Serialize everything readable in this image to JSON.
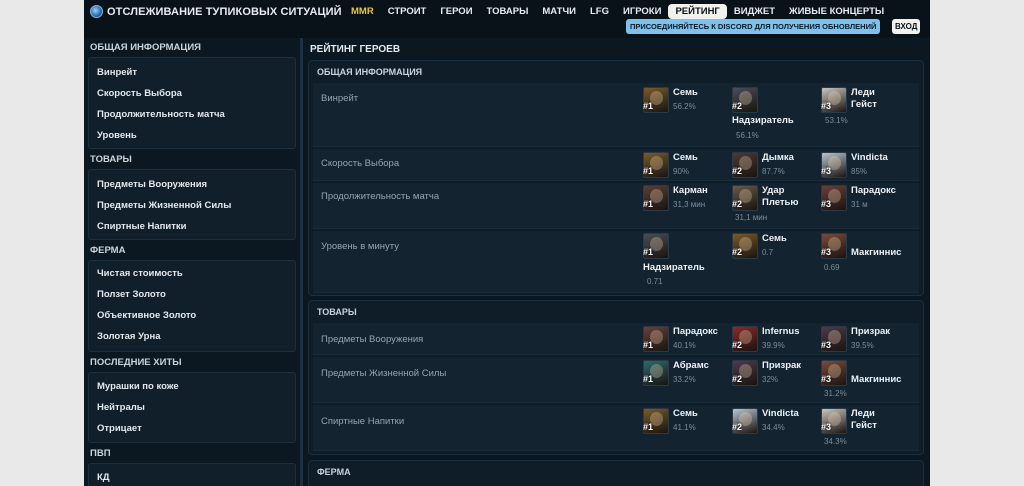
{
  "nav": {
    "brand_title": "ОТСЛЕЖИВАНИЕ ТУПИКОВЫХ СИТУАЦИЙ",
    "links": [
      "MMR",
      "СТРОИТ",
      "ГЕРОИ",
      "ТОВАРЫ",
      "МАТЧИ",
      "LFG",
      "ИГРОКИ",
      "РЕЙТИНГ",
      "ВИДЖЕТ",
      "ЖИВЫЕ КОНЦЕРТЫ"
    ],
    "active_link": "РЕЙТИНГ",
    "discord_banner": "ПРИСОЕДИНЯЙТЕСЬ К DISCORD ДЛЯ ПОЛУЧЕНИЯ ОБНОВЛЕНИЙ",
    "login_label": "ВХОД"
  },
  "sidebar": {
    "sections": [
      {
        "title": "ОБЩАЯ ИНФОРМАЦИЯ",
        "items": [
          "Винрейт",
          "Скорость Выбора",
          "Продолжительность матча",
          "Уровень"
        ]
      },
      {
        "title": "ТОВАРЫ",
        "items": [
          "Предметы Вооружения",
          "Предметы Жизненной Силы",
          "Спиртные Напитки"
        ]
      },
      {
        "title": "ФЕРМА",
        "items": [
          "Чистая стоимость",
          "Ползет Золото",
          "Объективное Золото",
          "Золотая Урна"
        ]
      },
      {
        "title": "ПОСЛЕДНИЕ ХИТЫ",
        "items": [
          "Мурашки по коже",
          "Нейтралы",
          "Отрицает"
        ]
      },
      {
        "title": "ПВП",
        "items": [
          "КД"
        ]
      }
    ]
  },
  "main": {
    "title": "РЕЙТИНГ ГЕРОЕВ",
    "panels": [
      {
        "title": "ОБЩАЯ ИНФОРМАЦИЯ",
        "rows": [
          {
            "label": "Винрейт",
            "heroes": [
              {
                "rank": "#1",
                "name": "Семь",
                "value": "56.2%",
                "color": "#7a5a2a"
              },
              {
                "rank": "#2",
                "name": "Надзиратель",
                "value": "56.1%",
                "color": "#4a4e58"
              },
              {
                "rank": "#3",
                "name": "Леди Гейст",
                "value": "53.1%",
                "color": "#c8c6c2"
              }
            ]
          },
          {
            "label": "Скорость Выбора",
            "heroes": [
              {
                "rank": "#1",
                "name": "Семь",
                "value": "90%",
                "color": "#7a5a2a"
              },
              {
                "rank": "#2",
                "name": "Дымка",
                "value": "87.7%",
                "color": "#4b3a30"
              },
              {
                "rank": "#3",
                "name": "Vindicta",
                "value": "85%",
                "color": "#b8c4d0"
              }
            ]
          },
          {
            "label": "Продолжительность матча",
            "heroes": [
              {
                "rank": "#1",
                "name": "Карман",
                "value": "31,3 мин",
                "color": "#5a3f35"
              },
              {
                "rank": "#2",
                "name": "Удар Плетью",
                "value": "31,1 мин",
                "color": "#6a5a48"
              },
              {
                "rank": "#3",
                "name": "Парадокс",
                "value": "31 м",
                "color": "#6a3f3a"
              }
            ]
          },
          {
            "label": "Уровень в минуту",
            "heroes": [
              {
                "rank": "#1",
                "name": "Надзиратель",
                "value": "0.71",
                "color": "#4a4e58"
              },
              {
                "rank": "#2",
                "name": "Семь",
                "value": "0.7",
                "color": "#7a5a2a"
              },
              {
                "rank": "#3",
                "name": "Макгиннис",
                "value": "0.69",
                "color": "#7a4a38"
              }
            ]
          }
        ]
      },
      {
        "title": "ТОВАРЫ",
        "rows": [
          {
            "label": "Предметы Вооружения",
            "heroes": [
              {
                "rank": "#1",
                "name": "Парадокс",
                "value": "40.1%",
                "color": "#6a3f3a"
              },
              {
                "rank": "#2",
                "name": "Infernus",
                "value": "39.9%",
                "color": "#8a2a2a"
              },
              {
                "rank": "#3",
                "name": "Призрак",
                "value": "39.5%",
                "color": "#4e3a48"
              }
            ]
          },
          {
            "label": "Предметы Жизненной Силы",
            "heroes": [
              {
                "rank": "#1",
                "name": "Абрамс",
                "value": "33.2%",
                "color": "#2a6a70"
              },
              {
                "rank": "#2",
                "name": "Призрак",
                "value": "32%",
                "color": "#4e3a48"
              },
              {
                "rank": "#3",
                "name": "Макгиннис",
                "value": "31.2%",
                "color": "#7a4a38"
              }
            ]
          },
          {
            "label": "Спиртные Напитки",
            "heroes": [
              {
                "rank": "#1",
                "name": "Семь",
                "value": "41.1%",
                "color": "#7a5a2a"
              },
              {
                "rank": "#2",
                "name": "Vindicta",
                "value": "34.4%",
                "color": "#b8c4d0"
              },
              {
                "rank": "#3",
                "name": "Леди Гейст",
                "value": "34.3%",
                "color": "#c8c6c2"
              }
            ]
          }
        ]
      },
      {
        "title": "ФЕРМА",
        "rows": []
      }
    ]
  }
}
